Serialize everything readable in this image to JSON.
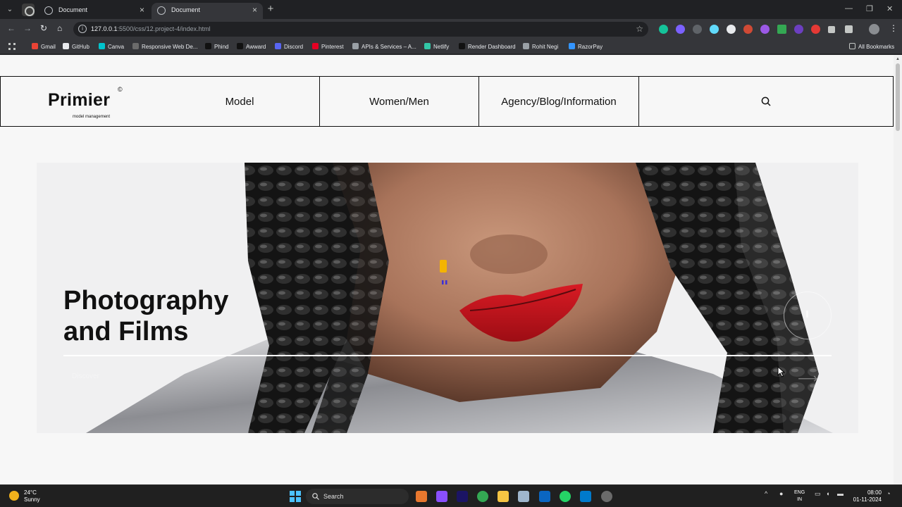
{
  "browser": {
    "tabs": [
      {
        "title": "Document",
        "active": false
      },
      {
        "title": "Document",
        "active": true
      }
    ],
    "url_host": "127.0.0.1",
    "url_path": ":5500/css/12.project-4/index.html",
    "bookmarks": [
      {
        "label": "Gmail",
        "color": "#ea4335"
      },
      {
        "label": "GitHub",
        "color": "#e8eaed"
      },
      {
        "label": "Canva",
        "color": "#00c4cc"
      },
      {
        "label": "Responsive Web De...",
        "color": "#6b6b6b"
      },
      {
        "label": "Phind",
        "color": "#111111"
      },
      {
        "label": "Awward",
        "color": "#111111"
      },
      {
        "label": "Discord",
        "color": "#5865f2"
      },
      {
        "label": "Pinterest",
        "color": "#e60023"
      },
      {
        "label": "APIs & Services – A...",
        "color": "#9aa0a6"
      },
      {
        "label": "Netlify",
        "color": "#32c6a6"
      },
      {
        "label": "Render Dashboard",
        "color": "#111111"
      },
      {
        "label": "Rohit Negi",
        "color": "#9aa0a6"
      },
      {
        "label": "RazorPay",
        "color": "#3395ff"
      }
    ],
    "all_bookmarks": "All Bookmarks"
  },
  "site": {
    "logo": "Primier",
    "logo_mark": "©",
    "tagline": "model management",
    "nav": [
      "Model",
      "Women/Men",
      "Agency/Blog/Information"
    ],
    "hero_title_line1": "Photography",
    "hero_title_line2": "and Films",
    "hero_caption": "Discover"
  },
  "taskbar": {
    "temperature": "24°C",
    "weather": "Sunny",
    "search_label": "Search",
    "lang_top": "ENG",
    "lang_bottom": "IN",
    "time": "08:00",
    "date": "01-11-2024"
  },
  "colors": {
    "accent": "#4cc2ff",
    "page_bg": "#f7f7f7",
    "lip": "#c8141c"
  }
}
